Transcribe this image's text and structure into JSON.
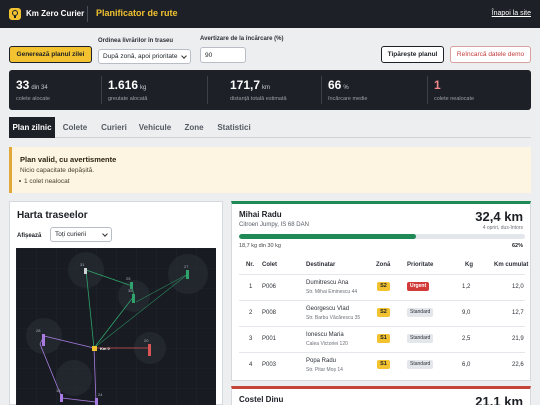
{
  "header": {
    "brand": "Km Zero Curier",
    "title": "Planificator de rute",
    "back_link": "Înapoi la site",
    "colors": {
      "bar": "#1d2026",
      "accent": "#f2c230"
    }
  },
  "controls": {
    "generate_label": "Generează planul zilei",
    "order_label": "Ordinea livrărilor în traseu",
    "order_value": "După zonă, apoi prioritate",
    "threshold_label": "Avertizare de la încărcare (%)",
    "threshold_value": "90",
    "print_label": "Tipărește planul",
    "reload_label": "Reîncarcă datele demo"
  },
  "stats": [
    {
      "value": "33",
      "unit": "din 34",
      "label": "colete alocate",
      "color": "#ffffff"
    },
    {
      "value": "1.616",
      "unit": "kg",
      "label": "greutate alocată",
      "color": "#ffffff"
    },
    {
      "value": "171,7",
      "unit": "km",
      "label": "distanță totală estimată",
      "color": "#ffffff"
    },
    {
      "value": "66",
      "unit": "%",
      "label": "încărcare medie",
      "color": "#ffffff"
    },
    {
      "value": "1",
      "unit": "",
      "label": "colete nealocate",
      "color": "#f08a8a"
    }
  ],
  "tabs": [
    "Plan zilnic",
    "Colete",
    "Curieri",
    "Vehicule",
    "Zone",
    "Statistici"
  ],
  "alert": {
    "title": "Plan valid, cu avertismente",
    "line": "Nicio capacitate depășită.",
    "bullet": "1 colet nealocat"
  },
  "map": {
    "title": "Harta traseelor",
    "show_label": "Afișează",
    "filter_value": "Toți curierii",
    "depot_label": "Km 0",
    "colors": {
      "bg": "#181c22",
      "route_green": "#2fa36b",
      "route_purple": "#a77be0",
      "route_red": "#d85555",
      "depot": "#f2c230"
    },
    "stop_labels": [
      "27",
      "31",
      "25",
      "35",
      "28",
      "20",
      "18",
      "24",
      "14",
      "12"
    ]
  },
  "route1": {
    "driver": "Mihai Radu",
    "vehicle": "Citroen Jumpy, IS 68 DAN",
    "distance": "32,4 km",
    "stops": "4 opriri, dus-întors",
    "load_text": "18,7 kg din 30 kg",
    "load_pct_text": "62%",
    "load_pct": 62,
    "headers": [
      "Nr.",
      "Colet",
      "Destinatar",
      "Zonă",
      "Prioritate",
      "Kg",
      "Km cumulat"
    ],
    "rows": [
      {
        "nr": "1",
        "colet": "P006",
        "name": "Dumitrescu Ana",
        "addr": "Str. Mihai Eminescu 44",
        "zone": "S2",
        "prio": "Urgent",
        "kg": "1,2",
        "km": "12,0"
      },
      {
        "nr": "2",
        "colet": "P008",
        "name": "Georgescu Vlad",
        "addr": "Str. Barbu Văcărescu 35",
        "zone": "S2",
        "prio": "Standard",
        "kg": "9,0",
        "km": "12,7"
      },
      {
        "nr": "3",
        "colet": "P001",
        "name": "Ionescu Maria",
        "addr": "Calea Victoriei 120",
        "zone": "S1",
        "prio": "Standard",
        "kg": "2,5",
        "km": "21,9"
      },
      {
        "nr": "4",
        "colet": "P003",
        "name": "Popa Radu",
        "addr": "Str. Pitar Moș 14",
        "zone": "S1",
        "prio": "Standard",
        "kg": "6,0",
        "km": "22,6"
      }
    ]
  },
  "route2": {
    "driver": "Costel Dinu",
    "distance": "21,1 km"
  }
}
